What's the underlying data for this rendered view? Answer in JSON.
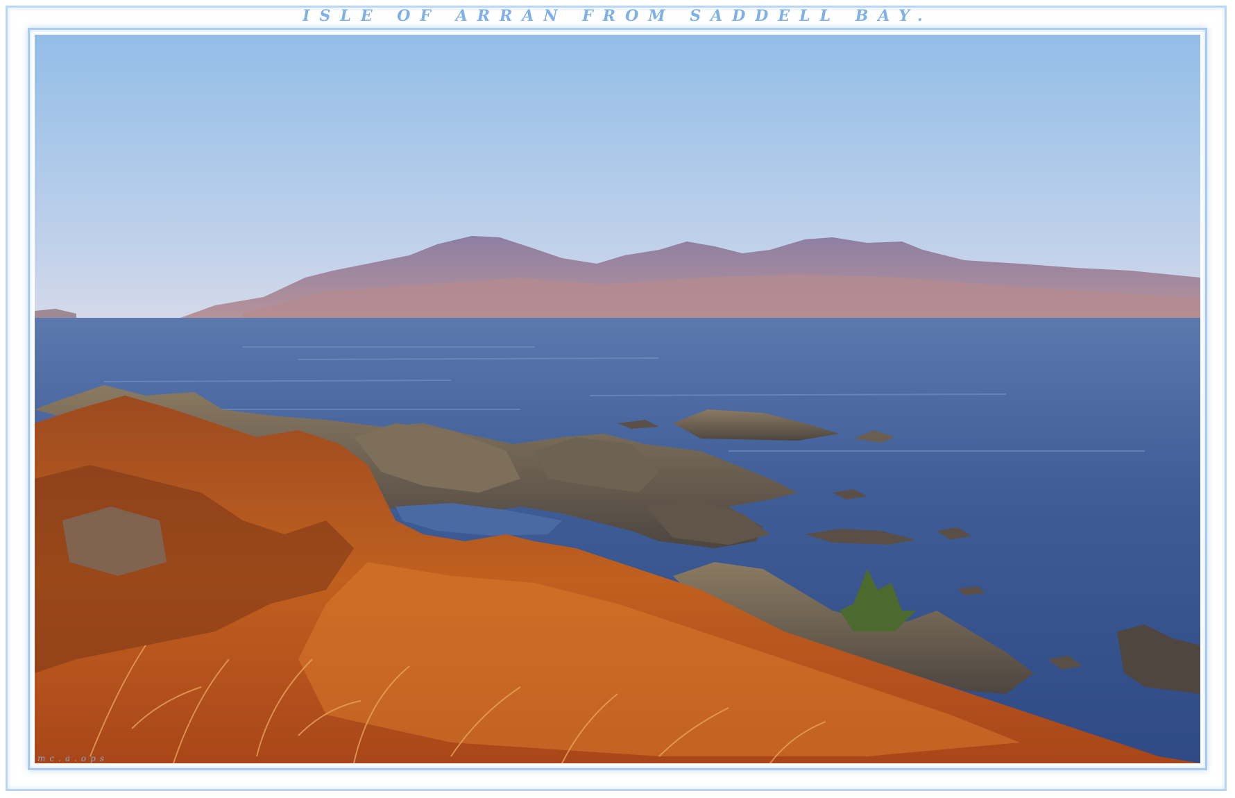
{
  "title": "ISLE OF ARRAN FROM SADDELL BAY.",
  "signature": "mc.a.ops",
  "colors": {
    "sky_top": "#9ec4ea",
    "sky_bottom": "#c5d4ea",
    "mountains": "#a48a9c",
    "sea": "#3f5f98",
    "rocks": "#6b5f52",
    "vegetation": "#b4541e",
    "frame": "#a9cbef"
  }
}
